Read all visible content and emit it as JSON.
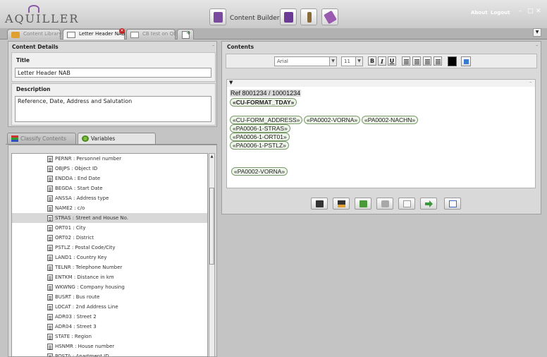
{
  "app": {
    "logo": "AQUILLER",
    "about": "About",
    "logout": "Logout",
    "content_builder": "Content Builder"
  },
  "tabs": [
    {
      "label": "Content Library"
    },
    {
      "label": "Letter Header NAB"
    },
    {
      "label": "CB test on QES"
    }
  ],
  "content_details": {
    "header": "Content Details",
    "title_label": "Title",
    "title_value": "Letter Header NAB",
    "description_label": "Description",
    "description_value": "Reference, Date, Address and Salutation"
  },
  "subtabs": {
    "classify": "Classify Contents",
    "variables": "Variables"
  },
  "variables": [
    {
      "code": "PERNR",
      "desc": "Personnel number"
    },
    {
      "code": "OBJPS",
      "desc": "Object ID"
    },
    {
      "code": "ENDDA",
      "desc": "End Date"
    },
    {
      "code": "BEGDA",
      "desc": "Start Date"
    },
    {
      "code": "ANSSA",
      "desc": "Address type"
    },
    {
      "code": "NAME2",
      "desc": "c/o"
    },
    {
      "code": "STRAS",
      "desc": "Street and House No."
    },
    {
      "code": "ORT01",
      "desc": "City"
    },
    {
      "code": "ORT02",
      "desc": "District"
    },
    {
      "code": "PSTLZ",
      "desc": "Postal Code/City"
    },
    {
      "code": "LAND1",
      "desc": "Country Key"
    },
    {
      "code": "TELNR",
      "desc": "Telephone Number"
    },
    {
      "code": "ENTKM",
      "desc": "Distance in km"
    },
    {
      "code": "WKWNG",
      "desc": "Company housing"
    },
    {
      "code": "BUSRT",
      "desc": "Bus route"
    },
    {
      "code": "LOCAT",
      "desc": "2nd Address Line"
    },
    {
      "code": "ADR03",
      "desc": "Street 2"
    },
    {
      "code": "ADR04",
      "desc": "Street 3"
    },
    {
      "code": "STATE",
      "desc": "Region"
    },
    {
      "code": "HSNMR",
      "desc": "House number"
    },
    {
      "code": "POSTA",
      "desc": "Apartment ID"
    }
  ],
  "selected_variable": "STRAS",
  "contents": {
    "header": "Contents",
    "font": "Arial",
    "size": "11",
    "bold": "B",
    "italic": "I",
    "underline": "U",
    "text_color": "#000000",
    "lines": {
      "ref": "Ref 8001234 / 10001234",
      "format": "«CU-FORMAT_TDAY»",
      "form_address": "«CU-FORM_ADDRESS»",
      "vorna": "«PA0002-VORNA»",
      "nachn": "«PA0002-NACHN»",
      "stras": "«PA0006-1-STRAS»",
      "ort01": "«PA0006-1-ORT01»",
      "pstlz": "«PA0006-1-PSTLZ»",
      "vorna2": "«PA0002-VORNA»"
    }
  },
  "colors": {
    "accent": "#7a4aa0",
    "tag_border": "#7a9a6a",
    "tag_bg": "#eef4ea"
  }
}
